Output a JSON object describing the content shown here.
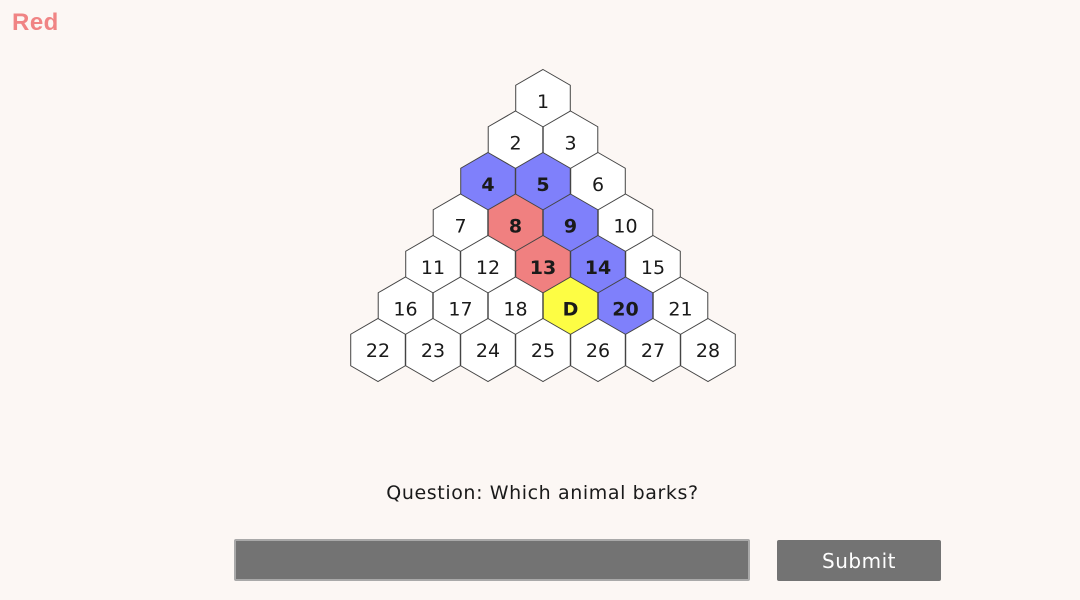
{
  "turn": {
    "label": "Red",
    "color": "#f08484"
  },
  "board": {
    "rows": 7,
    "colors": {
      "empty": "#ffffff",
      "red": "#f08080",
      "blue": "#7f80fb",
      "selected": "#fdfd44",
      "border": "#444444"
    },
    "cells": [
      {
        "label": "1",
        "state": "empty"
      },
      {
        "label": "2",
        "state": "empty"
      },
      {
        "label": "3",
        "state": "empty"
      },
      {
        "label": "4",
        "state": "blue"
      },
      {
        "label": "5",
        "state": "blue"
      },
      {
        "label": "6",
        "state": "empty"
      },
      {
        "label": "7",
        "state": "empty"
      },
      {
        "label": "8",
        "state": "red"
      },
      {
        "label": "9",
        "state": "blue"
      },
      {
        "label": "10",
        "state": "empty"
      },
      {
        "label": "11",
        "state": "empty"
      },
      {
        "label": "12",
        "state": "empty"
      },
      {
        "label": "13",
        "state": "red"
      },
      {
        "label": "14",
        "state": "blue"
      },
      {
        "label": "15",
        "state": "empty"
      },
      {
        "label": "16",
        "state": "empty"
      },
      {
        "label": "17",
        "state": "empty"
      },
      {
        "label": "18",
        "state": "empty"
      },
      {
        "label": "D",
        "state": "selected"
      },
      {
        "label": "20",
        "state": "blue"
      },
      {
        "label": "21",
        "state": "empty"
      },
      {
        "label": "22",
        "state": "empty"
      },
      {
        "label": "23",
        "state": "empty"
      },
      {
        "label": "24",
        "state": "empty"
      },
      {
        "label": "25",
        "state": "empty"
      },
      {
        "label": "26",
        "state": "empty"
      },
      {
        "label": "27",
        "state": "empty"
      },
      {
        "label": "28",
        "state": "empty"
      }
    ]
  },
  "question": {
    "text": "Question: Which animal barks?"
  },
  "answer": {
    "value": "",
    "placeholder": ""
  },
  "submit": {
    "label": "Submit"
  }
}
